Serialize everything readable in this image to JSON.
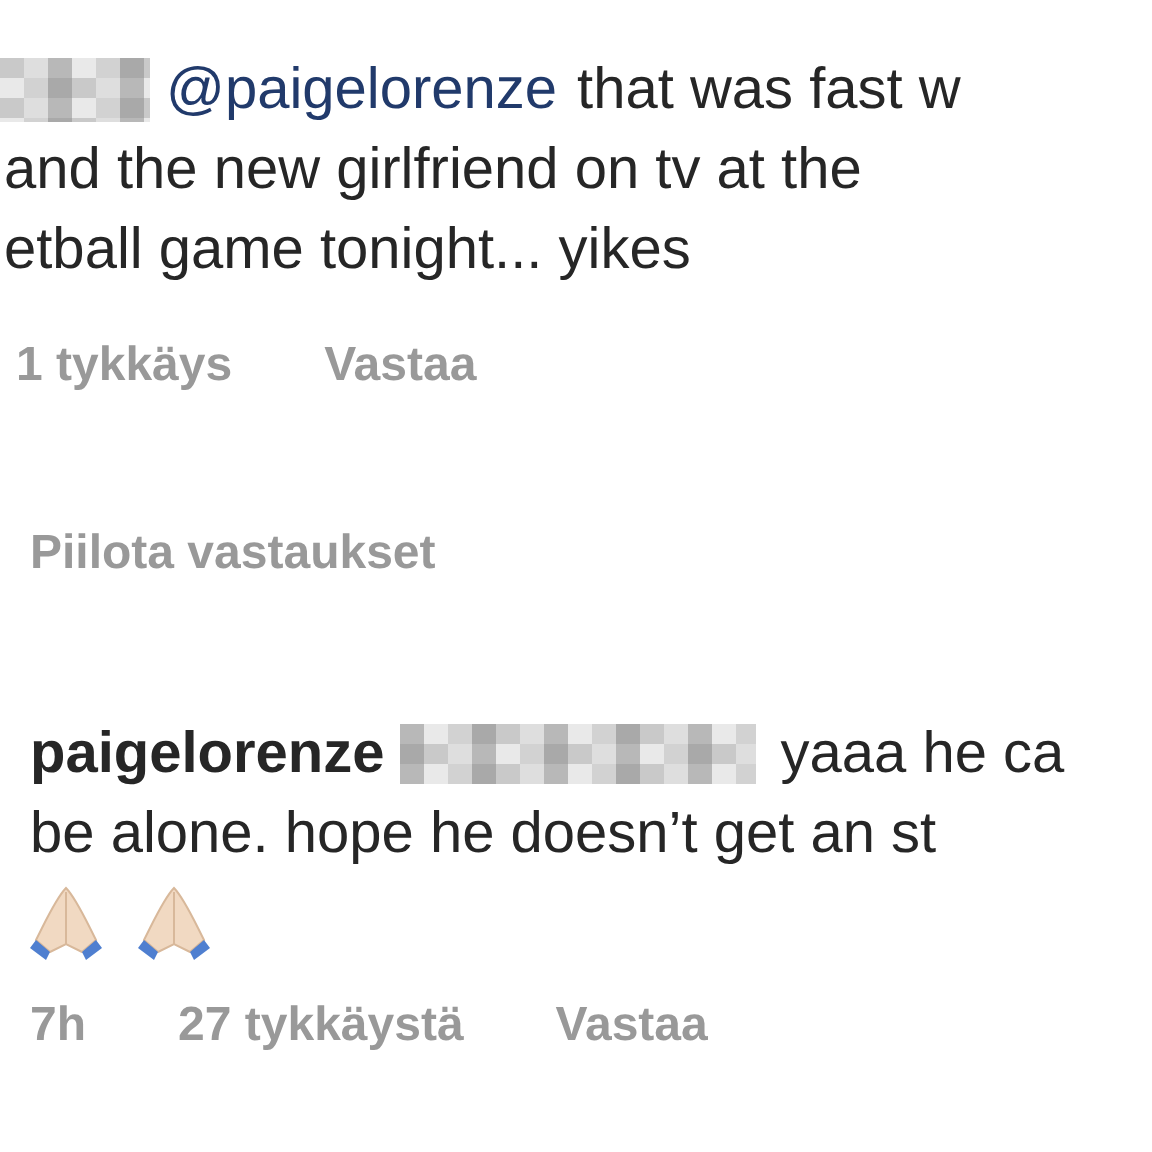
{
  "comment": {
    "mention": "@paigelorenze",
    "lines": [
      "that was fast w",
      "and the new girlfriend on tv at the",
      "etball game tonight... yikes"
    ],
    "likes": "1 tykkäys",
    "reply_action": "Vastaa"
  },
  "toggle_replies": "Piilota vastaukset",
  "reply": {
    "username": "paigelorenze",
    "lines": [
      "yaaa he ca",
      "be alone. hope he doesn’t get an st"
    ],
    "time": "7h",
    "likes": "27 tykkäystä",
    "reply_action": "Vastaa"
  }
}
